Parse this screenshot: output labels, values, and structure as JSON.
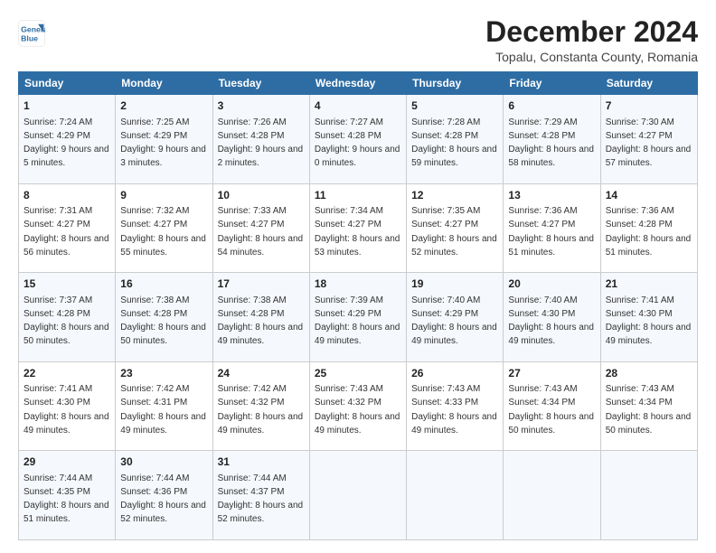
{
  "logo": {
    "line1": "General",
    "line2": "Blue"
  },
  "title": "December 2024",
  "subtitle": "Topalu, Constanta County, Romania",
  "header_days": [
    "Sunday",
    "Monday",
    "Tuesday",
    "Wednesday",
    "Thursday",
    "Friday",
    "Saturday"
  ],
  "weeks": [
    [
      {
        "day": "1",
        "sunrise": "7:24 AM",
        "sunset": "4:29 PM",
        "daylight": "9 hours and 5 minutes."
      },
      {
        "day": "2",
        "sunrise": "7:25 AM",
        "sunset": "4:29 PM",
        "daylight": "9 hours and 3 minutes."
      },
      {
        "day": "3",
        "sunrise": "7:26 AM",
        "sunset": "4:28 PM",
        "daylight": "9 hours and 2 minutes."
      },
      {
        "day": "4",
        "sunrise": "7:27 AM",
        "sunset": "4:28 PM",
        "daylight": "9 hours and 0 minutes."
      },
      {
        "day": "5",
        "sunrise": "7:28 AM",
        "sunset": "4:28 PM",
        "daylight": "8 hours and 59 minutes."
      },
      {
        "day": "6",
        "sunrise": "7:29 AM",
        "sunset": "4:28 PM",
        "daylight": "8 hours and 58 minutes."
      },
      {
        "day": "7",
        "sunrise": "7:30 AM",
        "sunset": "4:27 PM",
        "daylight": "8 hours and 57 minutes."
      }
    ],
    [
      {
        "day": "8",
        "sunrise": "7:31 AM",
        "sunset": "4:27 PM",
        "daylight": "8 hours and 56 minutes."
      },
      {
        "day": "9",
        "sunrise": "7:32 AM",
        "sunset": "4:27 PM",
        "daylight": "8 hours and 55 minutes."
      },
      {
        "day": "10",
        "sunrise": "7:33 AM",
        "sunset": "4:27 PM",
        "daylight": "8 hours and 54 minutes."
      },
      {
        "day": "11",
        "sunrise": "7:34 AM",
        "sunset": "4:27 PM",
        "daylight": "8 hours and 53 minutes."
      },
      {
        "day": "12",
        "sunrise": "7:35 AM",
        "sunset": "4:27 PM",
        "daylight": "8 hours and 52 minutes."
      },
      {
        "day": "13",
        "sunrise": "7:36 AM",
        "sunset": "4:27 PM",
        "daylight": "8 hours and 51 minutes."
      },
      {
        "day": "14",
        "sunrise": "7:36 AM",
        "sunset": "4:28 PM",
        "daylight": "8 hours and 51 minutes."
      }
    ],
    [
      {
        "day": "15",
        "sunrise": "7:37 AM",
        "sunset": "4:28 PM",
        "daylight": "8 hours and 50 minutes."
      },
      {
        "day": "16",
        "sunrise": "7:38 AM",
        "sunset": "4:28 PM",
        "daylight": "8 hours and 50 minutes."
      },
      {
        "day": "17",
        "sunrise": "7:38 AM",
        "sunset": "4:28 PM",
        "daylight": "8 hours and 49 minutes."
      },
      {
        "day": "18",
        "sunrise": "7:39 AM",
        "sunset": "4:29 PM",
        "daylight": "8 hours and 49 minutes."
      },
      {
        "day": "19",
        "sunrise": "7:40 AM",
        "sunset": "4:29 PM",
        "daylight": "8 hours and 49 minutes."
      },
      {
        "day": "20",
        "sunrise": "7:40 AM",
        "sunset": "4:30 PM",
        "daylight": "8 hours and 49 minutes."
      },
      {
        "day": "21",
        "sunrise": "7:41 AM",
        "sunset": "4:30 PM",
        "daylight": "8 hours and 49 minutes."
      }
    ],
    [
      {
        "day": "22",
        "sunrise": "7:41 AM",
        "sunset": "4:30 PM",
        "daylight": "8 hours and 49 minutes."
      },
      {
        "day": "23",
        "sunrise": "7:42 AM",
        "sunset": "4:31 PM",
        "daylight": "8 hours and 49 minutes."
      },
      {
        "day": "24",
        "sunrise": "7:42 AM",
        "sunset": "4:32 PM",
        "daylight": "8 hours and 49 minutes."
      },
      {
        "day": "25",
        "sunrise": "7:43 AM",
        "sunset": "4:32 PM",
        "daylight": "8 hours and 49 minutes."
      },
      {
        "day": "26",
        "sunrise": "7:43 AM",
        "sunset": "4:33 PM",
        "daylight": "8 hours and 49 minutes."
      },
      {
        "day": "27",
        "sunrise": "7:43 AM",
        "sunset": "4:34 PM",
        "daylight": "8 hours and 50 minutes."
      },
      {
        "day": "28",
        "sunrise": "7:43 AM",
        "sunset": "4:34 PM",
        "daylight": "8 hours and 50 minutes."
      }
    ],
    [
      {
        "day": "29",
        "sunrise": "7:44 AM",
        "sunset": "4:35 PM",
        "daylight": "8 hours and 51 minutes."
      },
      {
        "day": "30",
        "sunrise": "7:44 AM",
        "sunset": "4:36 PM",
        "daylight": "8 hours and 52 minutes."
      },
      {
        "day": "31",
        "sunrise": "7:44 AM",
        "sunset": "4:37 PM",
        "daylight": "8 hours and 52 minutes."
      },
      null,
      null,
      null,
      null
    ]
  ]
}
